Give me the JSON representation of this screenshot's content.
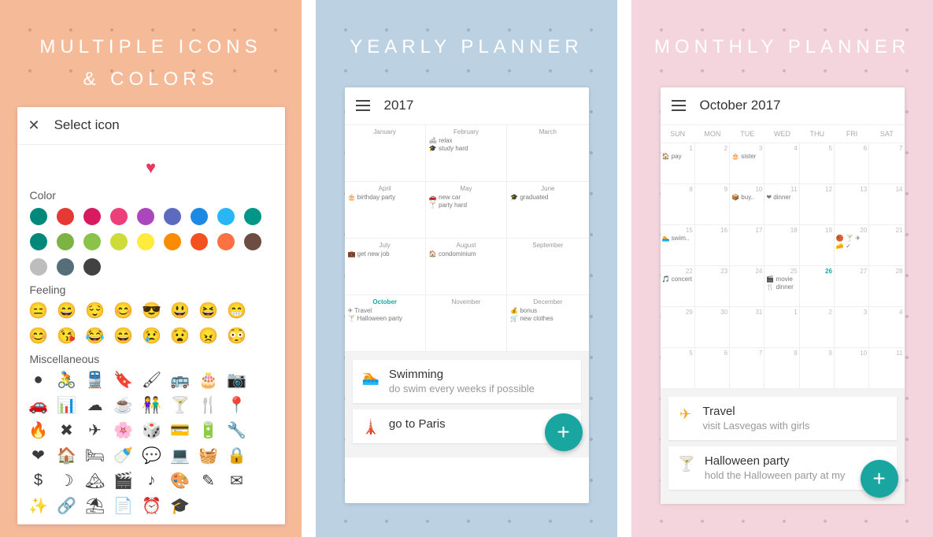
{
  "panel1": {
    "hero_line1": "MULTIPLE ICONS",
    "hero_line2": "& COLORS",
    "title": "Select icon",
    "labels": {
      "color": "Color",
      "feeling": "Feeling",
      "misc": "Miscellaneous"
    },
    "colors": [
      "#00897B",
      "#E53935",
      "#D81B60",
      "#EC407A",
      "#AB47BC",
      "#5C6BC0",
      "#1E88E5",
      "#29B6F6",
      "#009688",
      "#00897B",
      "#7CB342",
      "#8BC34A",
      "#CDDC39",
      "#FFEB3B",
      "#FB8C00",
      "#F4511E",
      "#FF7043",
      "#6D4C41",
      "#BDBDBD",
      "#546E7A",
      "#424242"
    ],
    "feelings": [
      "😑",
      "😄",
      "😌",
      "😊",
      "😎",
      "😃",
      "😆",
      "😁",
      "😊",
      "😘",
      "😂",
      "😄",
      "😢",
      "😧",
      "😠",
      "😳"
    ],
    "misc": [
      "●",
      "🚴",
      "🚆",
      "🔖",
      "🖌",
      "🚌",
      "🎂",
      "📷",
      "🚗",
      "📊",
      "☁",
      "☕",
      "👫",
      "🍸",
      "🍴",
      "📍",
      "🔥",
      "✖",
      "✈",
      "🌸",
      "🎲",
      "💳",
      "🔋",
      "🔧",
      "❤",
      "🏠",
      "🛏",
      "🍼",
      "💬",
      "💻",
      "🧺",
      "🔒",
      "$",
      "☽",
      "🏔",
      "🎬",
      "♪",
      "🎨",
      "✎",
      "✉",
      "✨",
      "🔗",
      "⛱",
      "📄",
      "⏰",
      "🎓"
    ]
  },
  "panel2": {
    "hero": "YEARLY PLANNER",
    "title": "2017",
    "months": [
      {
        "name": "January",
        "entries": []
      },
      {
        "name": "February",
        "entries": [
          "🛋 relax",
          "🎓 study hard"
        ]
      },
      {
        "name": "March",
        "entries": []
      },
      {
        "name": "April",
        "entries": [
          "🎂 birthday party"
        ]
      },
      {
        "name": "May",
        "entries": [
          "🚗 new car",
          "🍸 party hard"
        ]
      },
      {
        "name": "June",
        "entries": [
          "🎓 graduated"
        ]
      },
      {
        "name": "July",
        "entries": [
          "💼 get new job"
        ]
      },
      {
        "name": "August",
        "entries": [
          "🏠 condominium"
        ]
      },
      {
        "name": "September",
        "entries": []
      },
      {
        "name": "October",
        "active": true,
        "entries": [
          "✈ Travel",
          "🍸 Halloween party"
        ]
      },
      {
        "name": "November",
        "entries": []
      },
      {
        "name": "December",
        "entries": [
          "💰 bonus",
          "🛒 new clothes"
        ]
      }
    ],
    "tasks": [
      {
        "icon": "🏊",
        "icon_color": "#1AA6A0",
        "title": "Swimming",
        "desc": "do swim every weeks if possible"
      },
      {
        "icon": "🗼",
        "icon_color": "#E6395F",
        "title": "go to Paris",
        "desc": ""
      }
    ]
  },
  "panel3": {
    "hero": "MONTHLY PLANNER",
    "title": "October 2017",
    "wdays": [
      "SUN",
      "MON",
      "TUE",
      "WED",
      "THU",
      "FRI",
      "SAT"
    ],
    "cells": [
      {
        "d": "1",
        "e": [
          "🏠 pay"
        ]
      },
      {
        "d": "2",
        "e": []
      },
      {
        "d": "3",
        "e": [
          "🎂 sister"
        ]
      },
      {
        "d": "4",
        "e": []
      },
      {
        "d": "5",
        "e": []
      },
      {
        "d": "6",
        "e": []
      },
      {
        "d": "7",
        "e": []
      },
      {
        "d": "8",
        "e": []
      },
      {
        "d": "9",
        "e": []
      },
      {
        "d": "10",
        "e": [
          "📦 buy.."
        ]
      },
      {
        "d": "11",
        "e": [
          "❤ dinner"
        ]
      },
      {
        "d": "12",
        "e": []
      },
      {
        "d": "13",
        "e": []
      },
      {
        "d": "14",
        "e": []
      },
      {
        "d": "15",
        "e": [
          "🏊 swim.."
        ]
      },
      {
        "d": "16",
        "e": []
      },
      {
        "d": "17",
        "e": []
      },
      {
        "d": "18",
        "e": []
      },
      {
        "d": "19",
        "e": []
      },
      {
        "d": "20",
        "e": [
          "🏀 🍸 ✈",
          "🧀 ✓"
        ]
      },
      {
        "d": "21",
        "e": []
      },
      {
        "d": "22",
        "e": [
          "🎵 concert"
        ]
      },
      {
        "d": "23",
        "e": []
      },
      {
        "d": "24",
        "e": []
      },
      {
        "d": "25",
        "e": [
          "🎬 movie",
          "🍴 dinner"
        ]
      },
      {
        "d": "26",
        "active": true,
        "e": []
      },
      {
        "d": "27",
        "e": []
      },
      {
        "d": "28",
        "e": []
      },
      {
        "d": "29",
        "e": []
      },
      {
        "d": "30",
        "e": []
      },
      {
        "d": "31",
        "e": []
      },
      {
        "d": "1",
        "e": []
      },
      {
        "d": "2",
        "e": []
      },
      {
        "d": "3",
        "e": []
      },
      {
        "d": "4",
        "e": []
      },
      {
        "d": "5",
        "e": []
      },
      {
        "d": "6",
        "e": []
      },
      {
        "d": "7",
        "e": []
      },
      {
        "d": "8",
        "e": []
      },
      {
        "d": "9",
        "e": []
      },
      {
        "d": "10",
        "e": []
      },
      {
        "d": "11",
        "e": []
      }
    ],
    "tasks": [
      {
        "icon": "✈",
        "icon_color": "#F9A825",
        "title": "Travel",
        "desc": "visit Lasvegas with girls"
      },
      {
        "icon": "🍸",
        "icon_color": "#FB8C00",
        "title": "Halloween party",
        "desc": "hold the Halloween party at my"
      }
    ]
  }
}
